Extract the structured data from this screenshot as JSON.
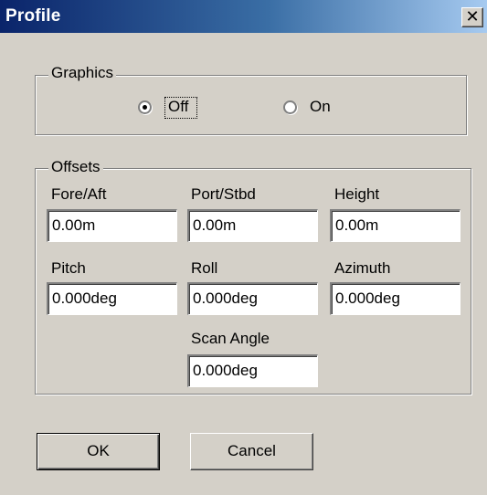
{
  "window": {
    "title": "Profile",
    "close_glyph": "✕"
  },
  "graphics": {
    "label": "Graphics",
    "options": [
      {
        "label": "Off",
        "selected": true
      },
      {
        "label": "On",
        "selected": false
      }
    ]
  },
  "offsets": {
    "label": "Offsets",
    "fields": {
      "fore_aft": {
        "label": "Fore/Aft",
        "value": "0.00m"
      },
      "port_stbd": {
        "label": "Port/Stbd",
        "value": "0.00m"
      },
      "height": {
        "label": "Height",
        "value": "0.00m"
      },
      "pitch": {
        "label": "Pitch",
        "value": "0.000deg"
      },
      "roll": {
        "label": "Roll",
        "value": "0.000deg"
      },
      "azimuth": {
        "label": "Azimuth",
        "value": "0.000deg"
      },
      "scan_angle": {
        "label": "Scan Angle",
        "value": "0.000deg"
      }
    }
  },
  "buttons": {
    "ok": "OK",
    "cancel": "Cancel"
  },
  "icons": {
    "close": "close-icon"
  }
}
